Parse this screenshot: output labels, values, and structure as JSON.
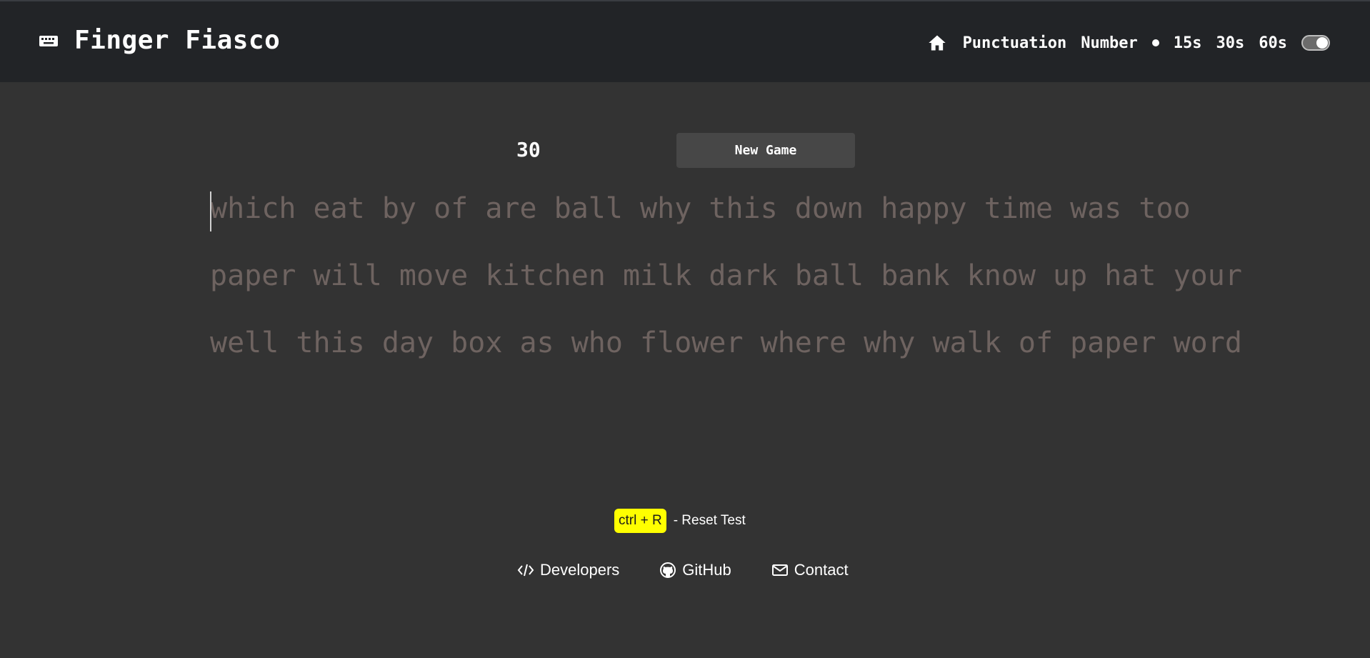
{
  "app": {
    "title": "Finger Fiasco"
  },
  "header": {
    "logo_icon": "keyboard-icon",
    "home_icon": "home-icon",
    "options": {
      "punctuation": "Punctuation",
      "number": "Number"
    },
    "durations": [
      "15s",
      "30s",
      "60s"
    ],
    "theme_toggle": {
      "state": "on"
    }
  },
  "game": {
    "timer": "30",
    "new_game_label": "New Game",
    "lines": [
      "which eat by of are ball why this down happy time was too",
      "paper will move kitchen milk dark ball bank know up hat your",
      "well this day box as who flower where why walk of paper word"
    ]
  },
  "shortcut": {
    "key": "ctrl + R",
    "description": "- Reset Test"
  },
  "footer": {
    "links": [
      {
        "label": "Developers",
        "icon": "code-icon"
      },
      {
        "label": "GitHub",
        "icon": "github-icon"
      },
      {
        "label": "Contact",
        "icon": "mail-icon"
      }
    ]
  },
  "colors": {
    "background": "#333333",
    "header": "#222427",
    "word_text": "#6e6360",
    "button": "#474747",
    "shortcut_key": "#ffff00"
  }
}
